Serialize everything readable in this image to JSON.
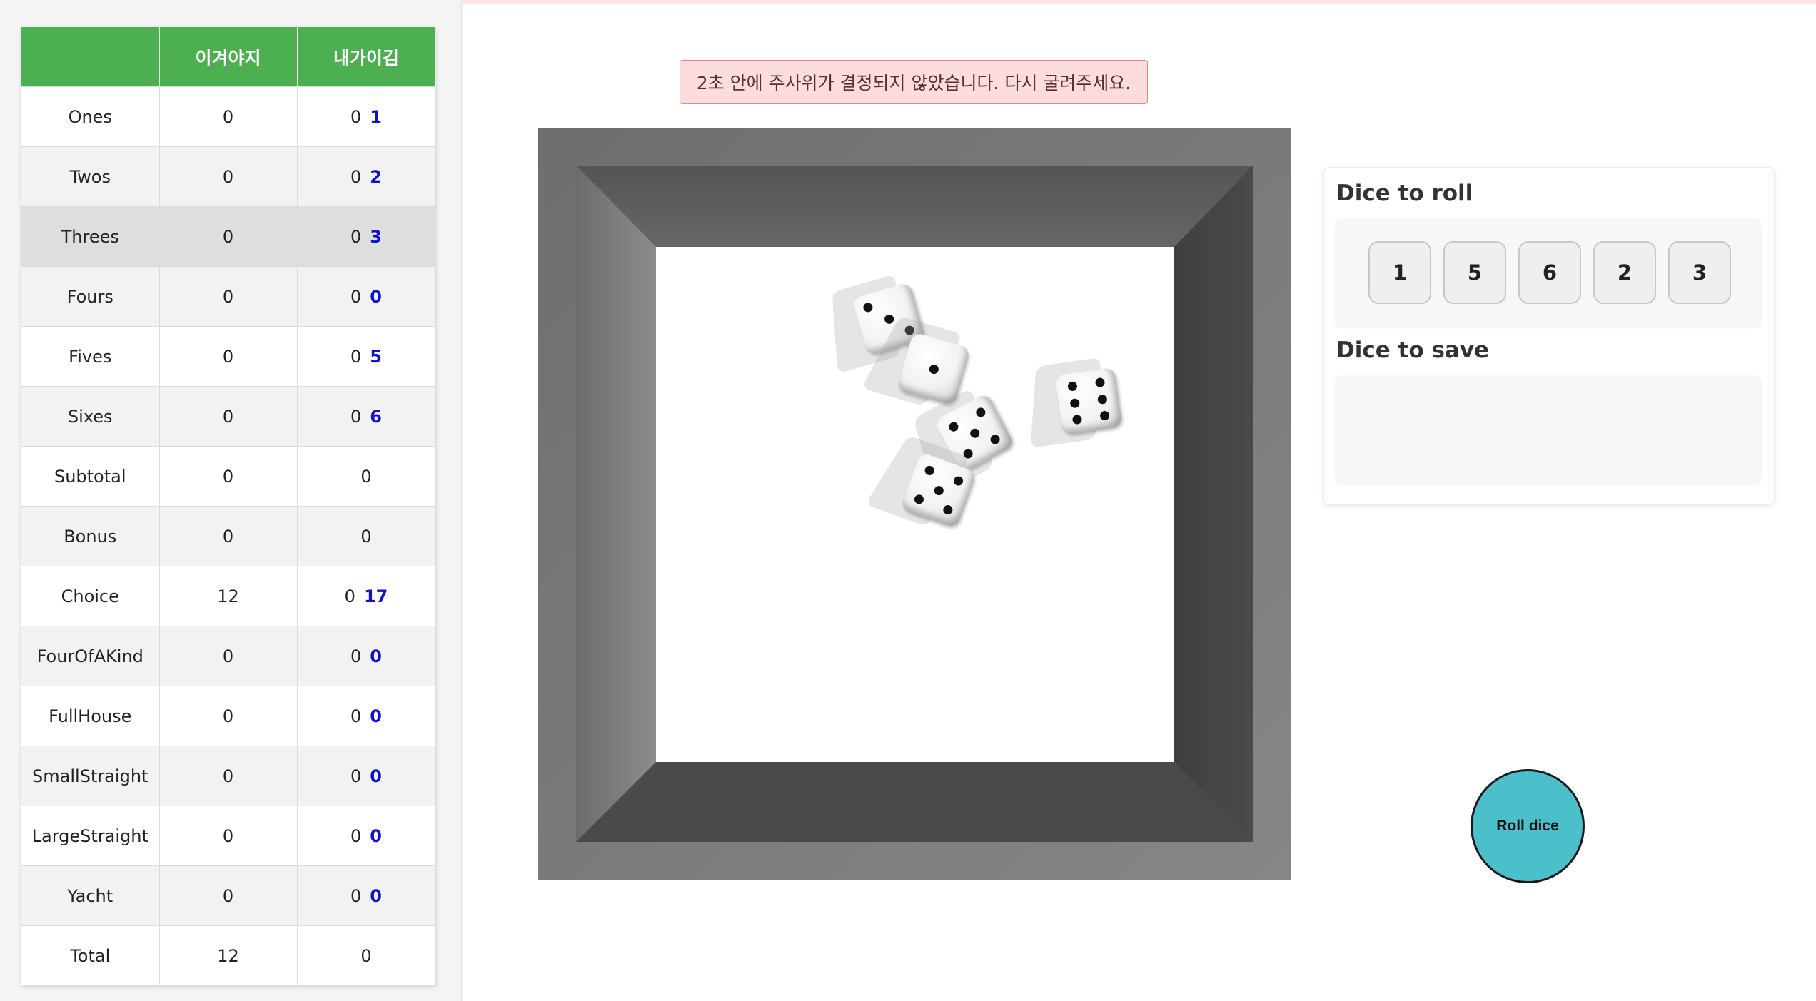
{
  "scoreboard": {
    "headers": [
      "",
      "이겨야지",
      "내가이김"
    ],
    "rows": [
      {
        "category": "Ones",
        "player1": "0",
        "player2": "0",
        "potential": "1"
      },
      {
        "category": "Twos",
        "player1": "0",
        "player2": "0",
        "potential": "2"
      },
      {
        "category": "Threes",
        "player1": "0",
        "player2": "0",
        "potential": "3"
      },
      {
        "category": "Fours",
        "player1": "0",
        "player2": "0",
        "potential": "0"
      },
      {
        "category": "Fives",
        "player1": "0",
        "player2": "0",
        "potential": "5"
      },
      {
        "category": "Sixes",
        "player1": "0",
        "player2": "0",
        "potential": "6"
      },
      {
        "category": "Subtotal",
        "player1": "0",
        "player2": "0",
        "potential": ""
      },
      {
        "category": "Bonus",
        "player1": "0",
        "player2": "0",
        "potential": ""
      },
      {
        "category": "Choice",
        "player1": "12",
        "player2": "0",
        "potential": "17"
      },
      {
        "category": "FourOfAKind",
        "player1": "0",
        "player2": "0",
        "potential": "0"
      },
      {
        "category": "FullHouse",
        "player1": "0",
        "player2": "0",
        "potential": "0"
      },
      {
        "category": "SmallStraight",
        "player1": "0",
        "player2": "0",
        "potential": "0"
      },
      {
        "category": "LargeStraight",
        "player1": "0",
        "player2": "0",
        "potential": "0"
      },
      {
        "category": "Yacht",
        "player1": "0",
        "player2": "0",
        "potential": "0"
      },
      {
        "category": "Total",
        "player1": "12",
        "player2": "0",
        "potential": ""
      }
    ]
  },
  "message": "2초 안에 주사위가 결정되지 않았습니다. 다시 굴려주세요.",
  "tray": {
    "dice_faces": [
      3,
      1,
      5,
      5,
      6
    ]
  },
  "dice_panel": {
    "roll_heading": "Dice to roll",
    "save_heading": "Dice to save",
    "dice_to_roll": [
      "1",
      "5",
      "6",
      "2",
      "3"
    ],
    "dice_to_save": []
  },
  "roll_button_label": "Roll dice",
  "colors": {
    "header_green": "#4caf50",
    "potential_blue": "#1010d0",
    "roll_button": "#4bbfca",
    "message_bg": "#fcdcdc",
    "tray_frame": "#7a7a7a"
  }
}
